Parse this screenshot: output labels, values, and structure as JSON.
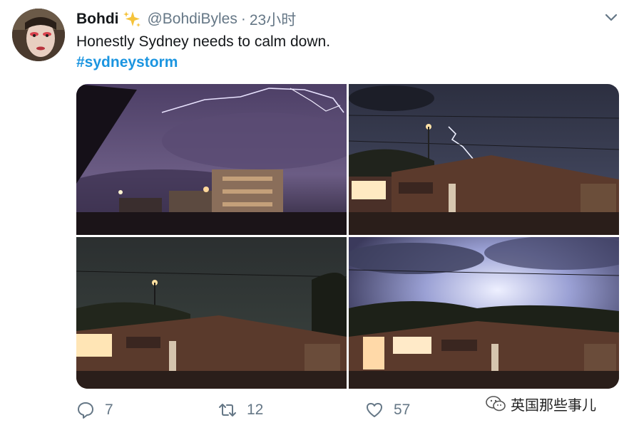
{
  "tweet": {
    "author_name": "Bohdi",
    "handle": "@BohdiByles",
    "separator": "·",
    "time": "23小时",
    "text": "Honestly Sydney needs to calm down.",
    "hashtag": "#sydneystorm"
  },
  "icons": {
    "verified_emoji": "sparkles-icon",
    "menu": "chevron-down-icon",
    "reply": "reply-icon",
    "retweet": "retweet-icon",
    "like": "heart-icon"
  },
  "actions": {
    "reply_count": "7",
    "retweet_count": "12",
    "like_count": "57"
  },
  "media": {
    "photo_count": 4
  },
  "watermark": {
    "text": "英国那些事儿"
  },
  "colors": {
    "link": "#1b95e0",
    "muted": "#657786",
    "text": "#14171a"
  }
}
